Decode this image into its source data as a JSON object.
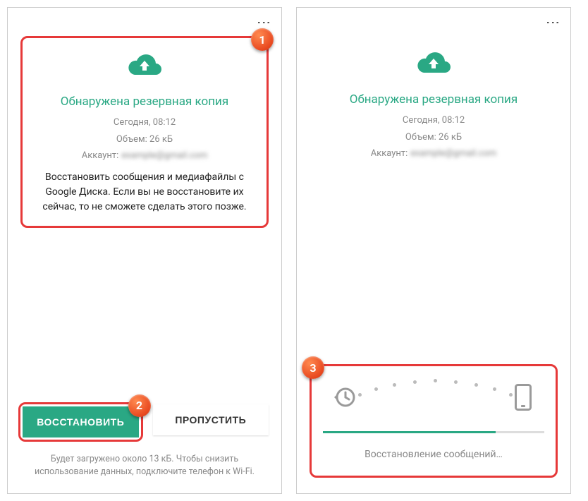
{
  "colors": {
    "accent": "#2aa884",
    "highlight": "#e63939",
    "badge": "#e8481f"
  },
  "screens": {
    "left": {
      "badge1": "1",
      "badge2": "2",
      "title": "Обнаружена резервная копия",
      "timestamp": "Сегодня, 08:12",
      "size": "Объем: 26 кБ",
      "account_label": "Аккаунт:",
      "account_value": "example@gmail.com",
      "description": "Восстановить сообщения и медиафайлы с Google Диска. Если вы не восстановите их сейчас, то не сможете сделать этого позже.",
      "restore_btn": "ВОССТАНОВИТЬ",
      "skip_btn": "ПРОПУСТИТЬ",
      "disclaimer": "Будет загружено около 13 кБ. Чтобы снизить использование данных, подключите телефон к Wi-Fi."
    },
    "right": {
      "badge3": "3",
      "title": "Обнаружена резервная копия",
      "timestamp": "Сегодня, 08:12",
      "size": "Объем: 26 кБ",
      "account_label": "Аккаунт:",
      "account_value": "example@gmail.com",
      "progress_text": "Восстановление сообщений…",
      "progress_pct": 78
    }
  }
}
